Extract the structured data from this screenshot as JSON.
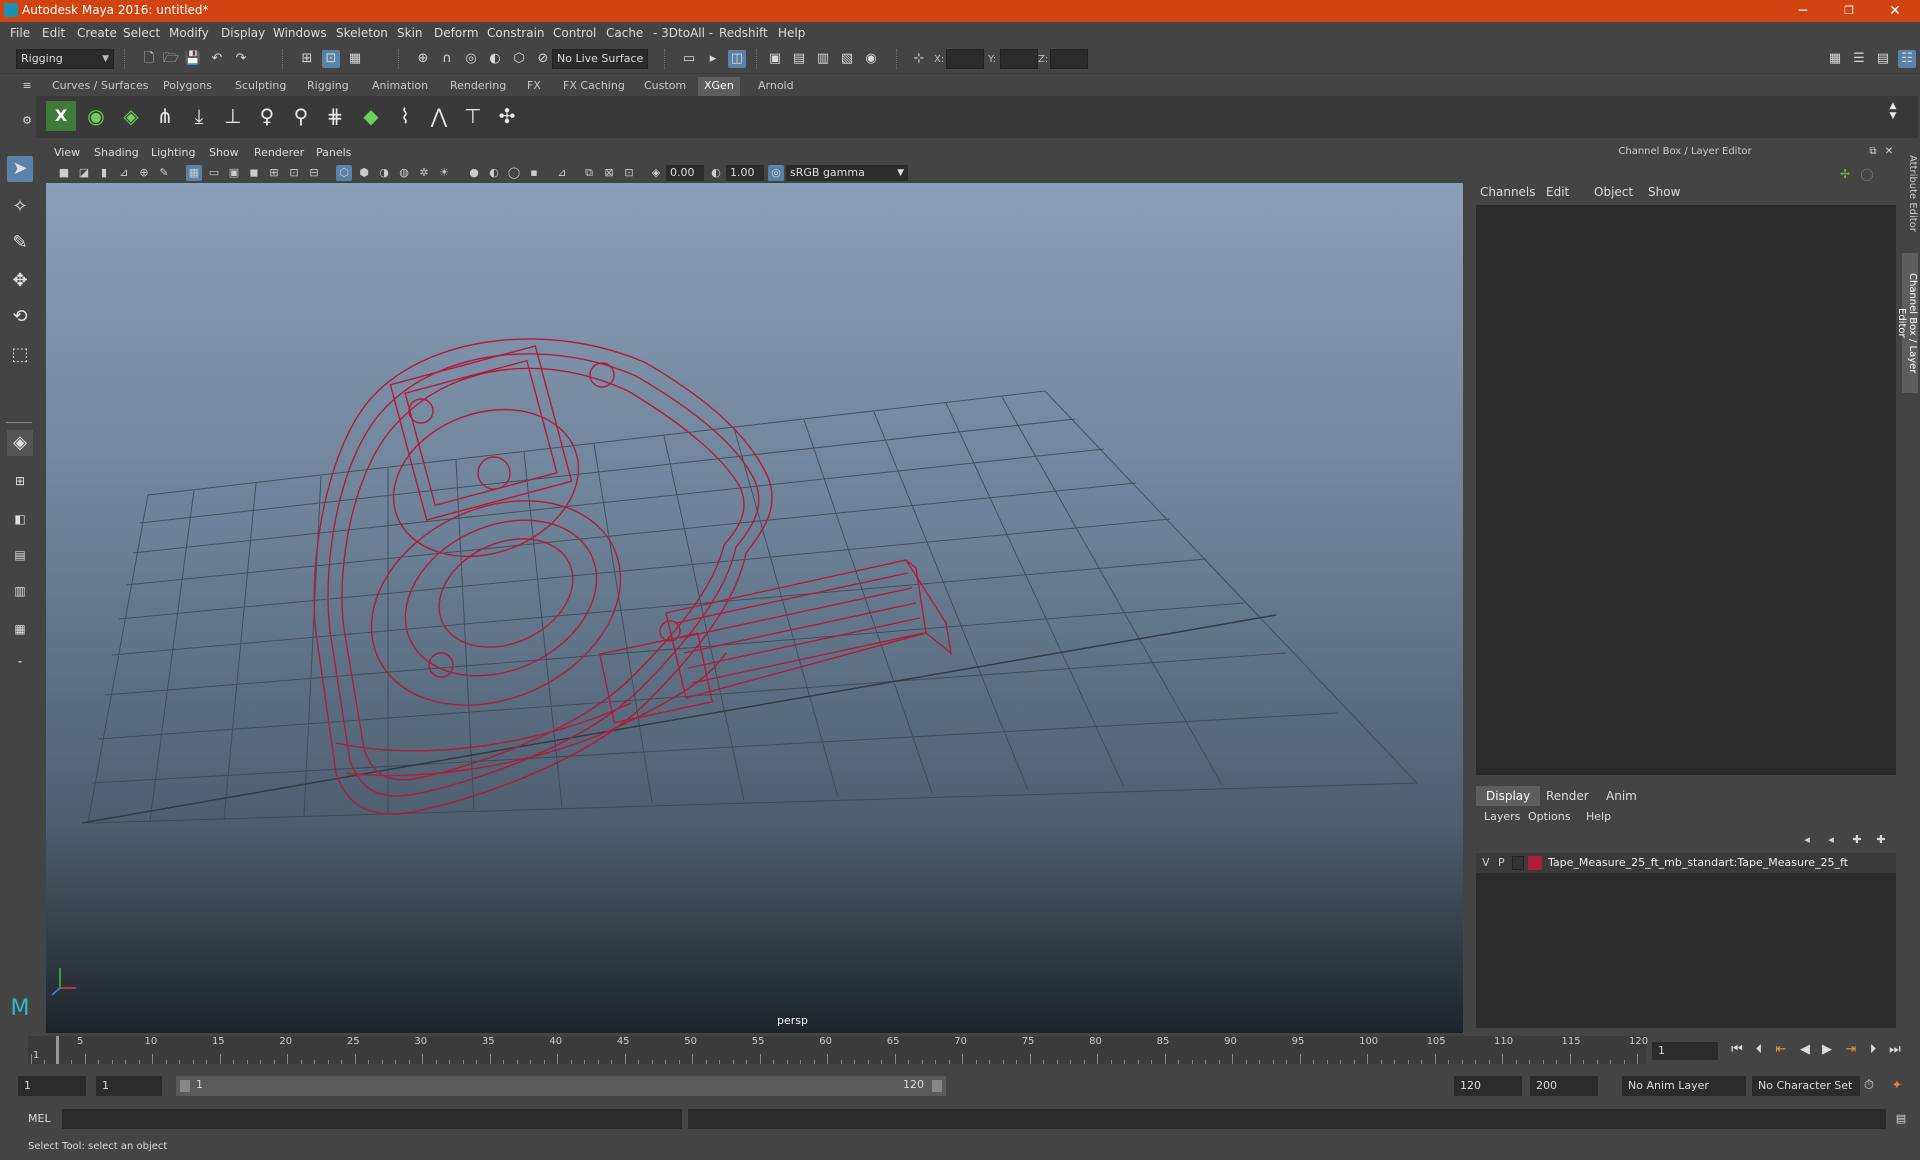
{
  "title_bar": {
    "title": "Autodesk Maya 2016: untitled*",
    "minimize": "─",
    "restore": "❐",
    "close": "✕"
  },
  "menus": [
    "File",
    "Edit",
    "Create",
    "Select",
    "Modify",
    "Display",
    "Windows",
    "Skeleton",
    "Skin",
    "Deform",
    "Constrain",
    "Control",
    "Cache",
    "- 3DtoAll -",
    "Redshift",
    "Help"
  ],
  "status_line": {
    "menuset": "Rigging",
    "live_surface": "No Live Surface",
    "x_label": "X:",
    "y_label": "Y:",
    "z_label": "Z:"
  },
  "shelf_tabs": [
    "Curves / Surfaces",
    "Polygons",
    "Sculpting",
    "Rigging",
    "Animation",
    "Rendering",
    "FX",
    "FX Caching",
    "Custom",
    "XGen",
    "Arnold"
  ],
  "active_shelf_tab": "XGen",
  "viewport": {
    "menus": [
      "View",
      "Shading",
      "Lighting",
      "Show",
      "Renderer",
      "Panels"
    ],
    "exposure": "0.00",
    "gamma": "1.00",
    "colorspace": "sRGB gamma",
    "camera": "persp"
  },
  "channel_box": {
    "title": "Channel Box / Layer Editor",
    "menus": [
      "Channels",
      "Edit",
      "Object",
      "Show"
    ],
    "layer_tabs": [
      "Display",
      "Render",
      "Anim"
    ],
    "active_layer_tab": "Display",
    "layer_menus": [
      "Layers",
      "Options",
      "Help"
    ],
    "layer": {
      "v": "V",
      "p": "P",
      "color": "#b01c3c",
      "name": "Tape_Measure_25_ft_mb_standart:Tape_Measure_25_ft"
    }
  },
  "side_tabs": [
    "Attribute Editor",
    "Channel Box / Layer Editor"
  ],
  "timeline": {
    "ticks": [
      "1",
      "5",
      "10",
      "15",
      "20",
      "25",
      "30",
      "35",
      "40",
      "45",
      "50",
      "55",
      "60",
      "65",
      "70",
      "75",
      "80",
      "85",
      "90",
      "95",
      "100",
      "105",
      "110",
      "115",
      "120"
    ],
    "current_frame": "1",
    "range_min": 1,
    "range_max": 120
  },
  "range": {
    "start": "1",
    "playback_start": "1",
    "slider_start": "1",
    "slider_end": "120",
    "playback_end": "120",
    "end": "200",
    "anim_layer": "No Anim Layer",
    "character_set": "No Character Set"
  },
  "command_line": {
    "label": "MEL"
  },
  "help_line": {
    "text": "Select Tool: select an object"
  },
  "colors": {
    "title_bar": "#d14310",
    "wireframe": "#b01c3c",
    "highlight": "#5a82a8"
  }
}
